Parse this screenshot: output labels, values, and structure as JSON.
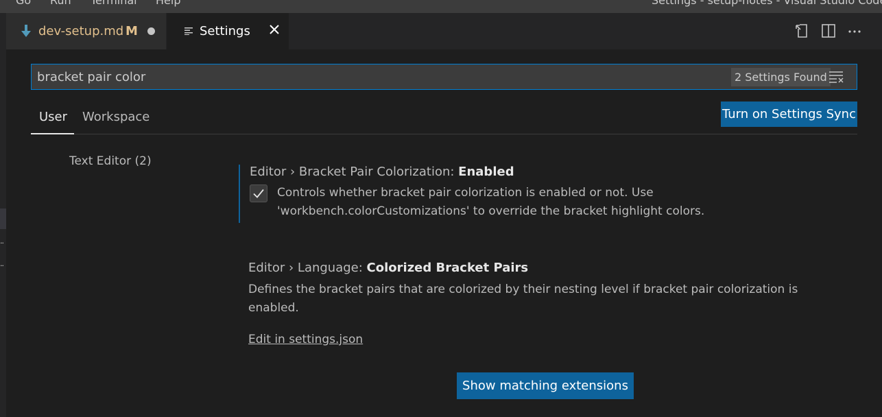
{
  "menu": {
    "items": [
      "Go",
      "Run",
      "Terminal",
      "Help"
    ]
  },
  "window": {
    "title": "Settings - setup-notes - Visual Studio Code"
  },
  "tabs": [
    {
      "label": "dev-setup.md",
      "status": "M",
      "icon": "markdown-icon"
    },
    {
      "label": "Settings",
      "icon": "settings-editor-icon"
    }
  ],
  "editor_actions": [
    "open-settings-json-icon",
    "split-editor-icon",
    "more-actions-icon"
  ],
  "search": {
    "value": "bracket pair color",
    "count": "2 Settings Found"
  },
  "scopes": {
    "user": "User",
    "workspace": "Workspace",
    "selected": "User"
  },
  "sync": {
    "label": "Turn on Settings Sync"
  },
  "toc": {
    "items": [
      {
        "label": "Text Editor (2)"
      }
    ]
  },
  "settings": [
    {
      "category": "Editor › Bracket Pair Colorization: ",
      "name": "Enabled",
      "checked": true,
      "description": "Controls whether bracket pair colorization is enabled or not. Use 'workbench.colorCustomizations' to override the bracket highlight colors."
    },
    {
      "category": "Editor › Language: ",
      "name": "Colorized Bracket Pairs",
      "description": "Defines the bracket pairs that are colorized by their nesting level if bracket pair colorization is enabled.",
      "link": "Edit in settings.json"
    }
  ],
  "extensions_button": {
    "label": "Show matching extensions"
  },
  "colors": {
    "accent": "#007fd4",
    "button": "#0e639c",
    "modified": "#e2c08d",
    "background": "#1e1e1e"
  }
}
